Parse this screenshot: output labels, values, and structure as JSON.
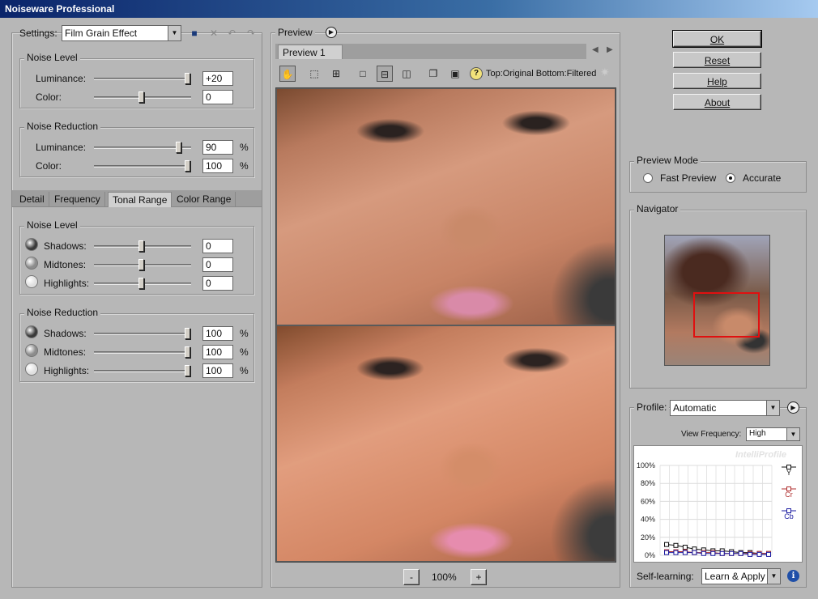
{
  "window": {
    "title": "Noiseware Professional"
  },
  "settings": {
    "label": "Settings:",
    "preset": "Film Grain Effect"
  },
  "top_noise_level": {
    "title": "Noise Level",
    "rows": [
      {
        "label": "Luminance:",
        "value": "+20",
        "unit": "",
        "slider": 1.0
      },
      {
        "label": "Color:",
        "value": "0",
        "unit": "",
        "slider": 0.5
      }
    ]
  },
  "top_noise_reduction": {
    "title": "Noise Reduction",
    "rows": [
      {
        "label": "Luminance:",
        "value": "90",
        "unit": "%",
        "slider": 0.9
      },
      {
        "label": "Color:",
        "value": "100",
        "unit": "%",
        "slider": 1.0
      }
    ]
  },
  "tabs": [
    "Detail",
    "Frequency",
    "Tonal Range",
    "Color Range"
  ],
  "active_tab": 2,
  "tonal_noise_level": {
    "title": "Noise Level",
    "rows": [
      {
        "label": "Shadows:",
        "value": "0",
        "unit": "",
        "slider": 0.5,
        "dot": "#3a3a3a"
      },
      {
        "label": "Midtones:",
        "value": "0",
        "unit": "",
        "slider": 0.5,
        "dot": "#8c8c8c"
      },
      {
        "label": "Highlights:",
        "value": "0",
        "unit": "",
        "slider": 0.5,
        "dot": "#e0e0e0"
      }
    ]
  },
  "tonal_noise_reduction": {
    "title": "Noise Reduction",
    "rows": [
      {
        "label": "Shadows:",
        "value": "100",
        "unit": "%",
        "slider": 1.0,
        "dot": "#3a3a3a"
      },
      {
        "label": "Midtones:",
        "value": "100",
        "unit": "%",
        "slider": 1.0,
        "dot": "#8c8c8c"
      },
      {
        "label": "Highlights:",
        "value": "100",
        "unit": "%",
        "slider": 1.0,
        "dot": "#e0e0e0"
      }
    ]
  },
  "preview": {
    "title": "Preview",
    "tab": "Preview 1",
    "caption": "Top:Original Bottom:Filtered",
    "zoom": "100%",
    "zoom_minus": "-",
    "zoom_plus": "+"
  },
  "buttons": {
    "ok": "OK",
    "reset": "Reset",
    "help": "Help",
    "about": "About"
  },
  "preview_mode": {
    "title": "Preview Mode",
    "options": [
      "Fast Preview",
      "Accurate"
    ],
    "selected": 1
  },
  "navigator": {
    "title": "Navigator"
  },
  "profile": {
    "label": "Profile:",
    "value": "Automatic",
    "view_frequency_label": "View Frequency:",
    "view_frequency_value": "High",
    "watermark": "IntelliProfile",
    "self_learning_label": "Self-learning:",
    "self_learning_value": "Learn & Apply"
  },
  "chart_data": {
    "type": "line",
    "ylim": [
      0,
      100
    ],
    "yticks": [
      "100%",
      "80%",
      "60%",
      "40%",
      "20%",
      "0%"
    ],
    "ytick_values": [
      100,
      80,
      60,
      40,
      20,
      0
    ],
    "x": [
      1,
      2,
      3,
      4,
      5,
      6,
      7,
      8,
      9,
      10,
      11,
      12
    ],
    "series": [
      {
        "name": "Y",
        "color": "#111111",
        "values": [
          12,
          11,
          9,
          7,
          6,
          5,
          5,
          4,
          3,
          3,
          2,
          2
        ]
      },
      {
        "name": "Cr",
        "color": "#b03030",
        "values": [
          4,
          4,
          4,
          3,
          3,
          3,
          2,
          2,
          2,
          2,
          2,
          2
        ]
      },
      {
        "name": "Cb",
        "color": "#1a1aa0",
        "values": [
          3,
          3,
          3,
          3,
          2,
          2,
          2,
          2,
          2,
          1,
          1,
          1
        ]
      }
    ]
  }
}
